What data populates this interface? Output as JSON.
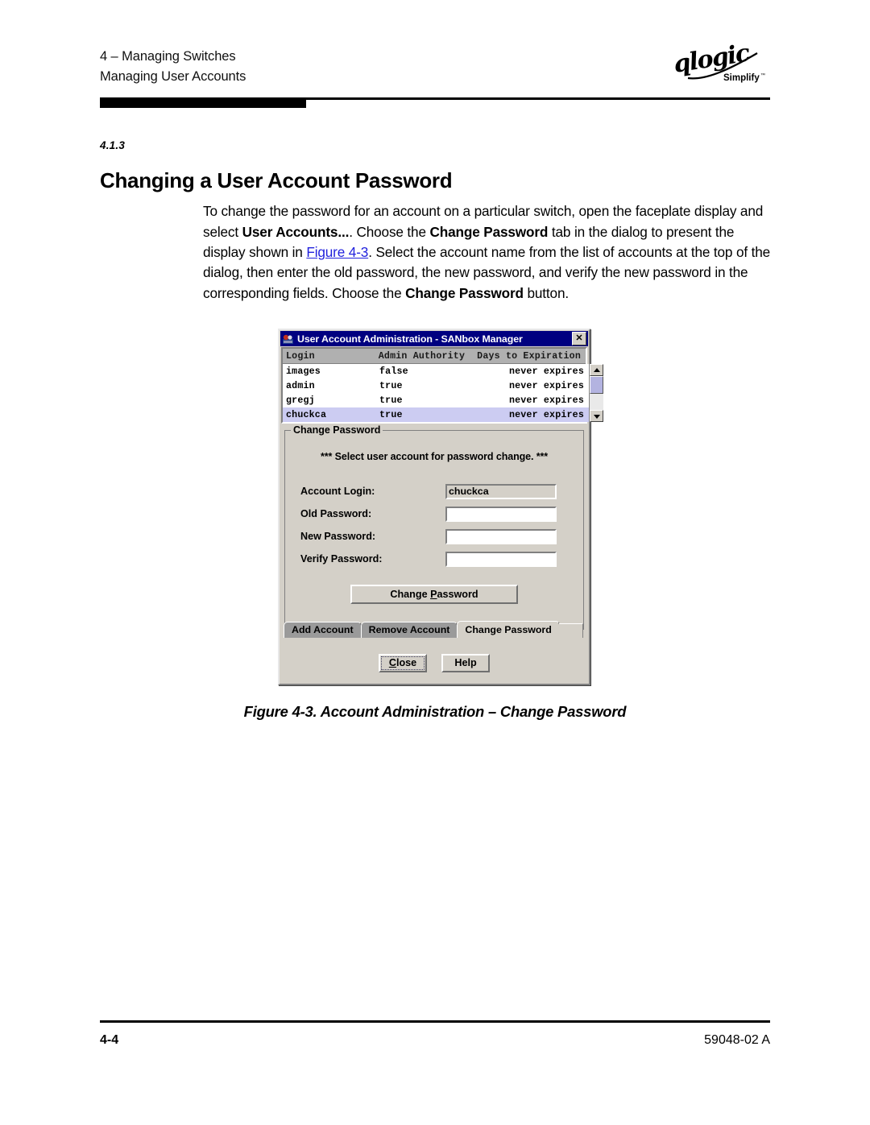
{
  "page": {
    "header_line1": "4 – Managing Switches",
    "header_line2": "Managing User Accounts",
    "logo_name": "qlogic",
    "logo_tagline": "Simplify",
    "logo_tm": "™"
  },
  "section": {
    "number": "4.1.3",
    "title": "Changing a User Account Password"
  },
  "paragraph": {
    "t1": "To change the password for an account on a particular switch, open the faceplate display and select ",
    "b1": "User Accounts...",
    "t2": ". Choose the ",
    "b2": "Change Password",
    "t3": " tab in the dialog to present the display shown in ",
    "link": "Figure 4-3",
    "t4": ". Select the account name from the list of accounts at the top of the dialog, then enter the old password, the new password, and verify the new password in the corresponding fields. Choose the ",
    "b3": "Change Password",
    "t5": " button."
  },
  "dialog": {
    "title": "User Account Administration - SANbox Manager",
    "close_label": "✕",
    "table": {
      "columns": [
        "Login",
        "Admin Authority",
        "Days to Expiration"
      ],
      "rows": [
        {
          "login": "images",
          "authority": "false",
          "expiration": "never expires",
          "selected": false
        },
        {
          "login": "admin",
          "authority": "true",
          "expiration": "never expires",
          "selected": false
        },
        {
          "login": "gregj",
          "authority": "true",
          "expiration": "never expires",
          "selected": false
        },
        {
          "login": "chuckca",
          "authority": "true",
          "expiration": "never expires",
          "selected": true
        }
      ]
    },
    "group": {
      "title": "Change Password",
      "note": "*** Select user account for password change. ***",
      "fields": [
        {
          "label": "Account Login:",
          "value": "chuckca",
          "readonly": true
        },
        {
          "label": "Old Password:",
          "value": "",
          "readonly": false
        },
        {
          "label": "New Password:",
          "value": "",
          "readonly": false
        },
        {
          "label": "Verify Password:",
          "value": "",
          "readonly": false
        }
      ],
      "action_button_pre": "Change ",
      "action_button_mnemonic": "P",
      "action_button_post": "assword"
    },
    "tabs": [
      {
        "label": "Add Account",
        "active": false
      },
      {
        "label": "Remove Account",
        "active": false
      },
      {
        "label": "Change Password",
        "active": true
      }
    ],
    "buttons": {
      "close_mnemonic": "C",
      "close_rest": "lose",
      "help": "Help"
    }
  },
  "figure": {
    "caption_number": "Figure 4-3.",
    "caption_text": " Account Administration – Change Password"
  },
  "footer": {
    "page_number": "4-4",
    "doc_number": "59048-02 A"
  },
  "colors": {
    "titlebar": "#000080",
    "dialog_face": "#d4d0c8",
    "selection": "#ccccf2",
    "link": "#2222dd"
  }
}
